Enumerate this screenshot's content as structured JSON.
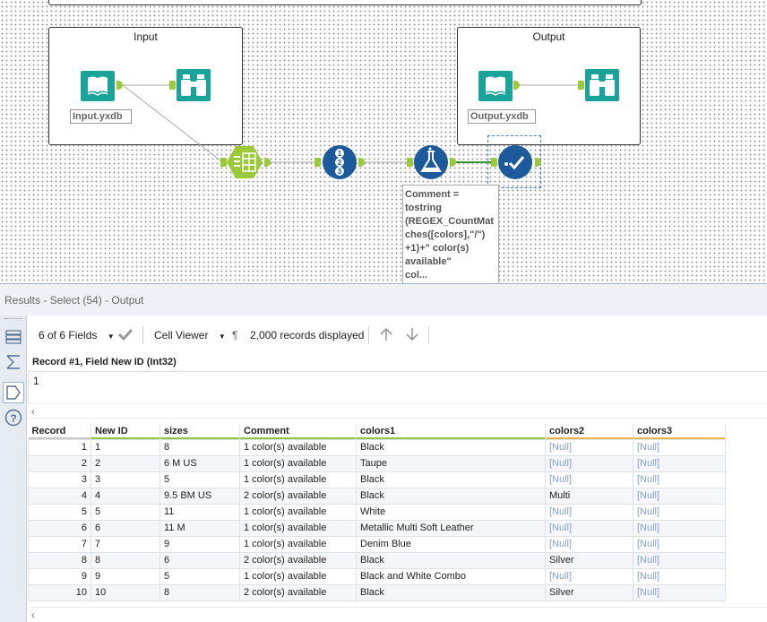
{
  "canvas": {
    "containers": [
      {
        "title": "Input"
      },
      {
        "title": "Output"
      }
    ],
    "labels": {
      "input_file": "Input.yxdb",
      "output_file": "Output.yxdb"
    },
    "annotation": "Comment =\ntostring\n(REGEX_CountMat\nches([colors],\"/\")\n+1)+\" color(s)\navailable\"\ncol...",
    "tool_icons": {
      "input": "book-icon",
      "browse": "binoculars-icon",
      "text_to_columns": "text-to-columns-icon",
      "record_id": "record-id-icon",
      "formula": "formula-flask-icon",
      "select": "select-checkmark-icon"
    },
    "colors": {
      "input_tool": "#1aa39a",
      "anchor": "#9bc93a",
      "blue_tool": "#1c5a9c",
      "parse_tool": "#9bc93a"
    }
  },
  "results": {
    "title": "Results - Select (54) - Output",
    "toolbar": {
      "fields": "6 of 6 Fields",
      "viewer": "Cell Viewer",
      "records": "2,000 records displayed"
    },
    "cell_header": "Record #1, Field New ID (Int32)",
    "cell_value": "1",
    "columns": [
      "Record",
      "New ID",
      "sizes",
      "Comment",
      "colors1",
      "colors2",
      "colors3"
    ],
    "rows": [
      [
        "1",
        "1",
        "8",
        "1 color(s) available",
        "Black",
        "[Null]",
        "[Null]"
      ],
      [
        "2",
        "2",
        "6 M US",
        "1 color(s) available",
        "Taupe",
        "[Null]",
        "[Null]"
      ],
      [
        "3",
        "3",
        "5",
        "1 color(s) available",
        "Black",
        "[Null]",
        "[Null]"
      ],
      [
        "4",
        "4",
        "9.5 BM US",
        "2 color(s) available",
        "Black",
        "Multi",
        "[Null]"
      ],
      [
        "5",
        "5",
        "11",
        "1 color(s) available",
        "White",
        "[Null]",
        "[Null]"
      ],
      [
        "6",
        "6",
        "11 M",
        "1 color(s) available",
        "Metallic Multi Soft Leather",
        "[Null]",
        "[Null]"
      ],
      [
        "7",
        "7",
        "9",
        "1 color(s) available",
        "Denim Blue",
        "[Null]",
        "[Null]"
      ],
      [
        "8",
        "8",
        "6",
        "2 color(s) available",
        "Black",
        "Silver",
        "[Null]"
      ],
      [
        "9",
        "9",
        "5",
        "1 color(s) available",
        "Black and White Combo",
        "[Null]",
        "[Null]"
      ],
      [
        "10",
        "10",
        "8",
        "2 color(s) available",
        "Black",
        "Silver",
        "[Null]"
      ]
    ]
  }
}
